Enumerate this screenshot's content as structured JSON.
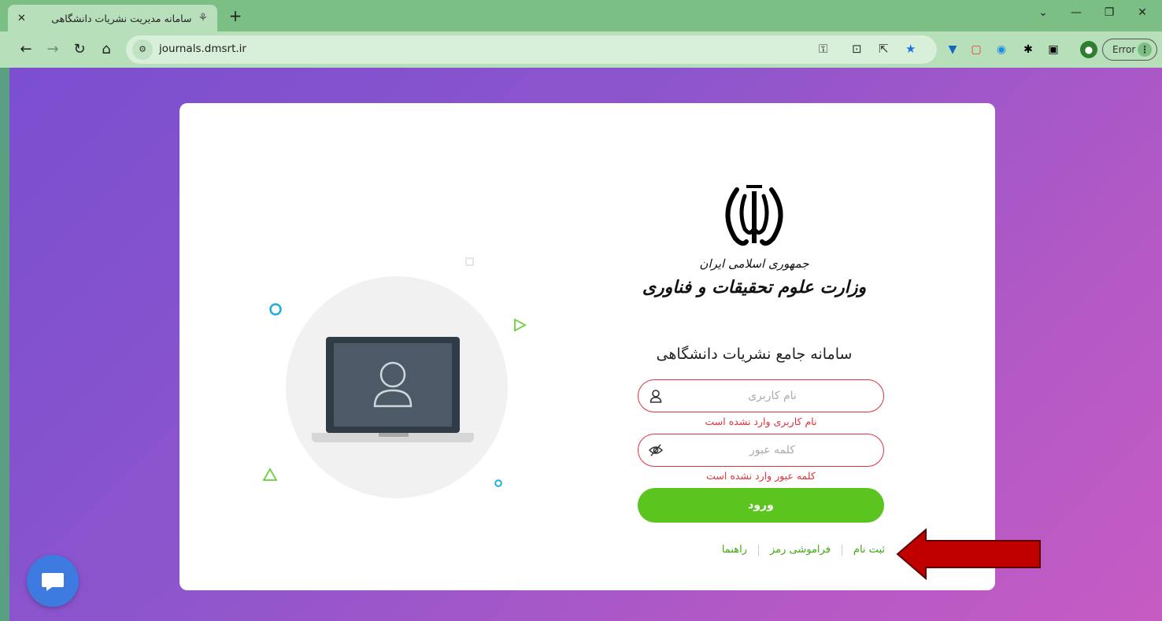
{
  "browser": {
    "tab_title": "سامانه مدیریت نشریات دانشگاهی",
    "tab_close": "✕",
    "new_tab": "+",
    "url": "journals.dmsrt.ir",
    "error_label": "Error",
    "menu_dots": "⋮"
  },
  "page": {
    "ministry_line1": "جمهوری اسلامی ایران",
    "ministry_line2": "وزارت علوم تحقیقات و فناوری",
    "system_title": "سامانه جامع نشریات دانشگاهی",
    "username_placeholder": "نام کاربری",
    "username_error": "نام کاربری وارد نشده است",
    "password_placeholder": "کلمه عبور",
    "password_error": "کلمه عبور وارد نشده است",
    "login_label": "ورود",
    "links": {
      "register": "ثبت نام",
      "forgot": "فراموشی رمز",
      "help": "راهنما"
    }
  },
  "colors": {
    "accent_green": "#5cc41e",
    "error_red": "#e0323a",
    "annotation_arrow": "#c00000"
  }
}
